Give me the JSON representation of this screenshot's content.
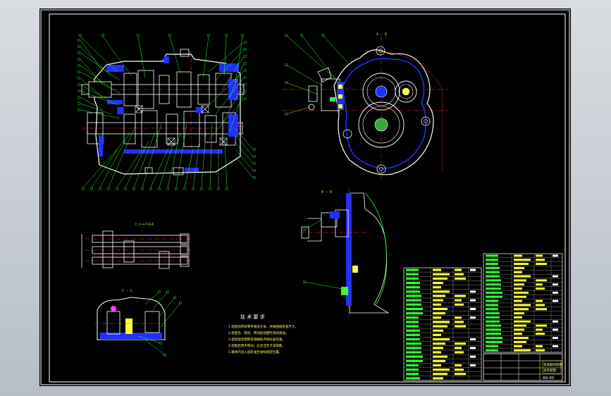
{
  "drawing": {
    "section_labels": {
      "top_right": "A — A",
      "mid_right": "B — B",
      "lower_left": "C — C",
      "mid_left_caption": "ﾧﾺﾶﾪﾫﾮ"
    },
    "tech_title": "技 术 要 求",
    "tech_notes": [
      "1.装配前所有零件清洗干净，并按图纸检查尺寸。",
      "2.各配合、密封、转动处装配时涂润滑油。",
      "3.齿轮啮合侧隙及接触斑点按标准检查。",
      "4.装配后用手转动，应灵活无卡滞现象。",
      "5.箱体内注入齿轮油至油标规定位置。"
    ],
    "title_block": {
      "name_line1": "变速器装配图",
      "name_line2": "总装配图",
      "drawing_no": "A0-00"
    }
  },
  "colors": {
    "frame": "#ffffff",
    "outline": "#ffffff",
    "section_fill": "#2030ff",
    "leader": "#33ff33",
    "center": "#ff3030",
    "bom_text": "#ffff33",
    "magenta": "#ff40ff",
    "cyan": "#33ffff"
  }
}
